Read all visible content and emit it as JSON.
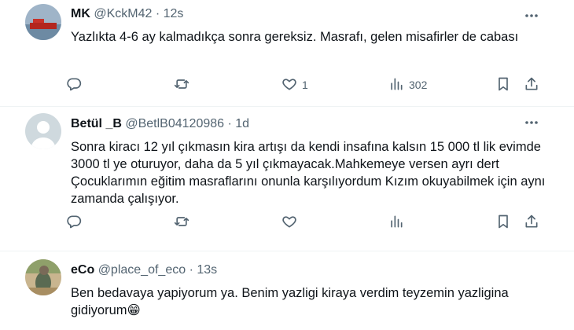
{
  "tweets": [
    {
      "name": "MK",
      "handle": "@KckM42",
      "dot": "·",
      "time": "12s",
      "text": "Yazlıkta 4-6 ay kalmadıkça sonra gereksiz. Masrafı, gelen misafirler de cabası",
      "likes": "1",
      "views": "302"
    },
    {
      "name": "Betül _B",
      "handle": "@BetlB04120986",
      "dot": "·",
      "time": "1d",
      "text": "Sonra kiracı 12 yıl çıkmasın kira artışı da kendi insafına kalsın 15  000 tl lik evimde 3000 tl ye oturuyor, daha da 5 yıl çıkmayacak.Mahkemeye versen ayrı dert Çocuklarımın eğitim masraflarını onunla karşılıyordum Kızım okuyabilmek için aynı zamanda çalışıyor."
    },
    {
      "name": "eCo",
      "handle": "@place_of_eco",
      "dot": "·",
      "time": "13s",
      "text": "Ben bedavaya yapiyorum ya. Benim yazligi kiraya verdim teyzemin yazligina gidiyorum😁"
    }
  ],
  "colors": {
    "text": "#0f1419",
    "muted": "#536471",
    "divider": "#eff3f4"
  },
  "icons": [
    "more-icon",
    "reply-icon",
    "retweet-icon",
    "like-icon",
    "views-icon",
    "bookmark-icon",
    "share-icon"
  ]
}
